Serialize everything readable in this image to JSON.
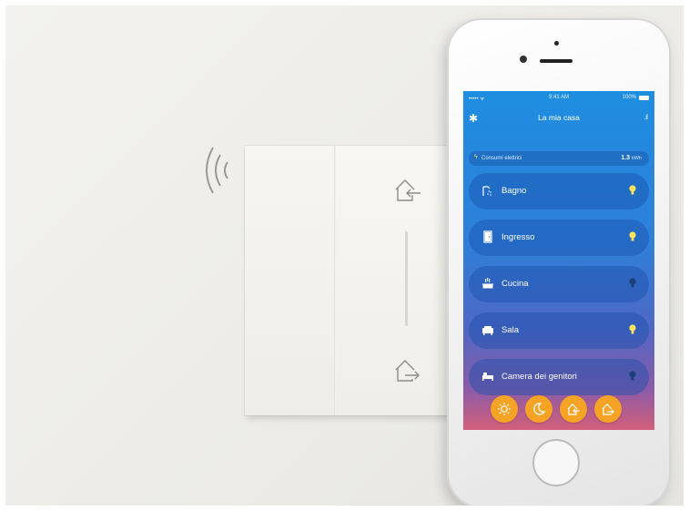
{
  "status_bar": {
    "carrier": "••••• ᯤ",
    "time": "9:41 AM",
    "battery": "100%"
  },
  "header": {
    "title": "La mia casa",
    "settings_icon": "gear-icon",
    "stats_icon": "bar-chart-icon"
  },
  "energy": {
    "label": "Consumi elettrici",
    "value": "1.3",
    "unit": "kWh",
    "icon": "lightning-icon"
  },
  "rooms": [
    {
      "label": "Bagno",
      "icon": "shower-icon",
      "light_on": true
    },
    {
      "label": "Ingresso",
      "icon": "door-icon",
      "light_on": true
    },
    {
      "label": "Cucina",
      "icon": "pot-icon",
      "light_on": false
    },
    {
      "label": "Sala",
      "icon": "sofa-icon",
      "light_on": true
    },
    {
      "label": "Camera dei genitori",
      "icon": "bed-icon",
      "light_on": false
    }
  ],
  "modes": [
    {
      "name": "sun-icon"
    },
    {
      "name": "moon-icon"
    },
    {
      "name": "home-arrive-icon"
    },
    {
      "name": "home-leave-icon"
    }
  ],
  "colors": {
    "accent": "#f5a324",
    "bulb_on": "#ffe35c",
    "bulb_off": "#1d3f7a"
  }
}
